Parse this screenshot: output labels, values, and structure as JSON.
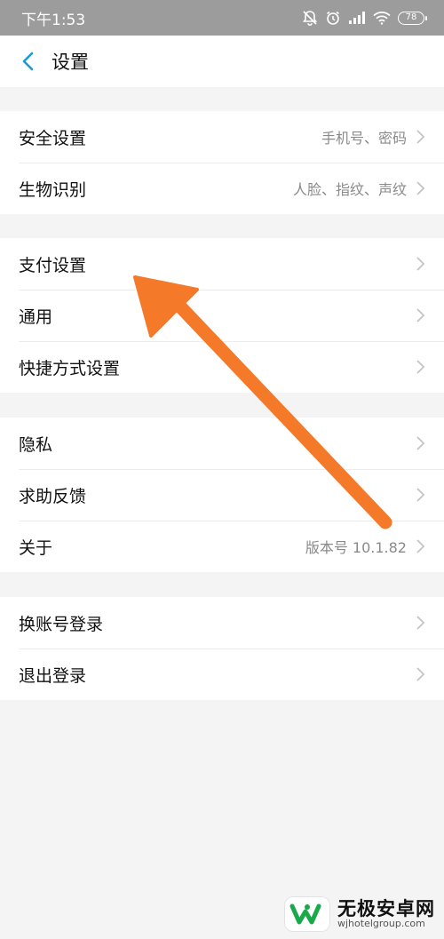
{
  "status": {
    "time": "下午1:53",
    "battery": "78",
    "icons": [
      "mute-icon",
      "alarm-icon",
      "signal-icon",
      "wifi-icon",
      "battery-icon"
    ]
  },
  "header": {
    "title": "设置",
    "back_icon": "chevron-left-icon"
  },
  "groups": [
    {
      "items": [
        {
          "label": "安全设置",
          "value": "手机号、密码"
        },
        {
          "label": "生物识别",
          "value": "人脸、指纹、声纹"
        }
      ]
    },
    {
      "items": [
        {
          "label": "支付设置",
          "value": ""
        },
        {
          "label": "通用",
          "value": ""
        },
        {
          "label": "快捷方式设置",
          "value": ""
        }
      ]
    },
    {
      "items": [
        {
          "label": "隐私",
          "value": ""
        },
        {
          "label": "求助反馈",
          "value": ""
        },
        {
          "label": "关于",
          "value": "版本号 10.1.82"
        }
      ]
    },
    {
      "items": [
        {
          "label": "换账号登录",
          "value": ""
        },
        {
          "label": "退出登录",
          "value": ""
        }
      ]
    }
  ],
  "colors": {
    "accent": "#1a9bd7",
    "annotation_arrow": "#f47a2a",
    "watermark_green": "#1aa94a"
  },
  "watermark": {
    "name": "无极安卓网",
    "url": "wjhotelgroup.com"
  }
}
